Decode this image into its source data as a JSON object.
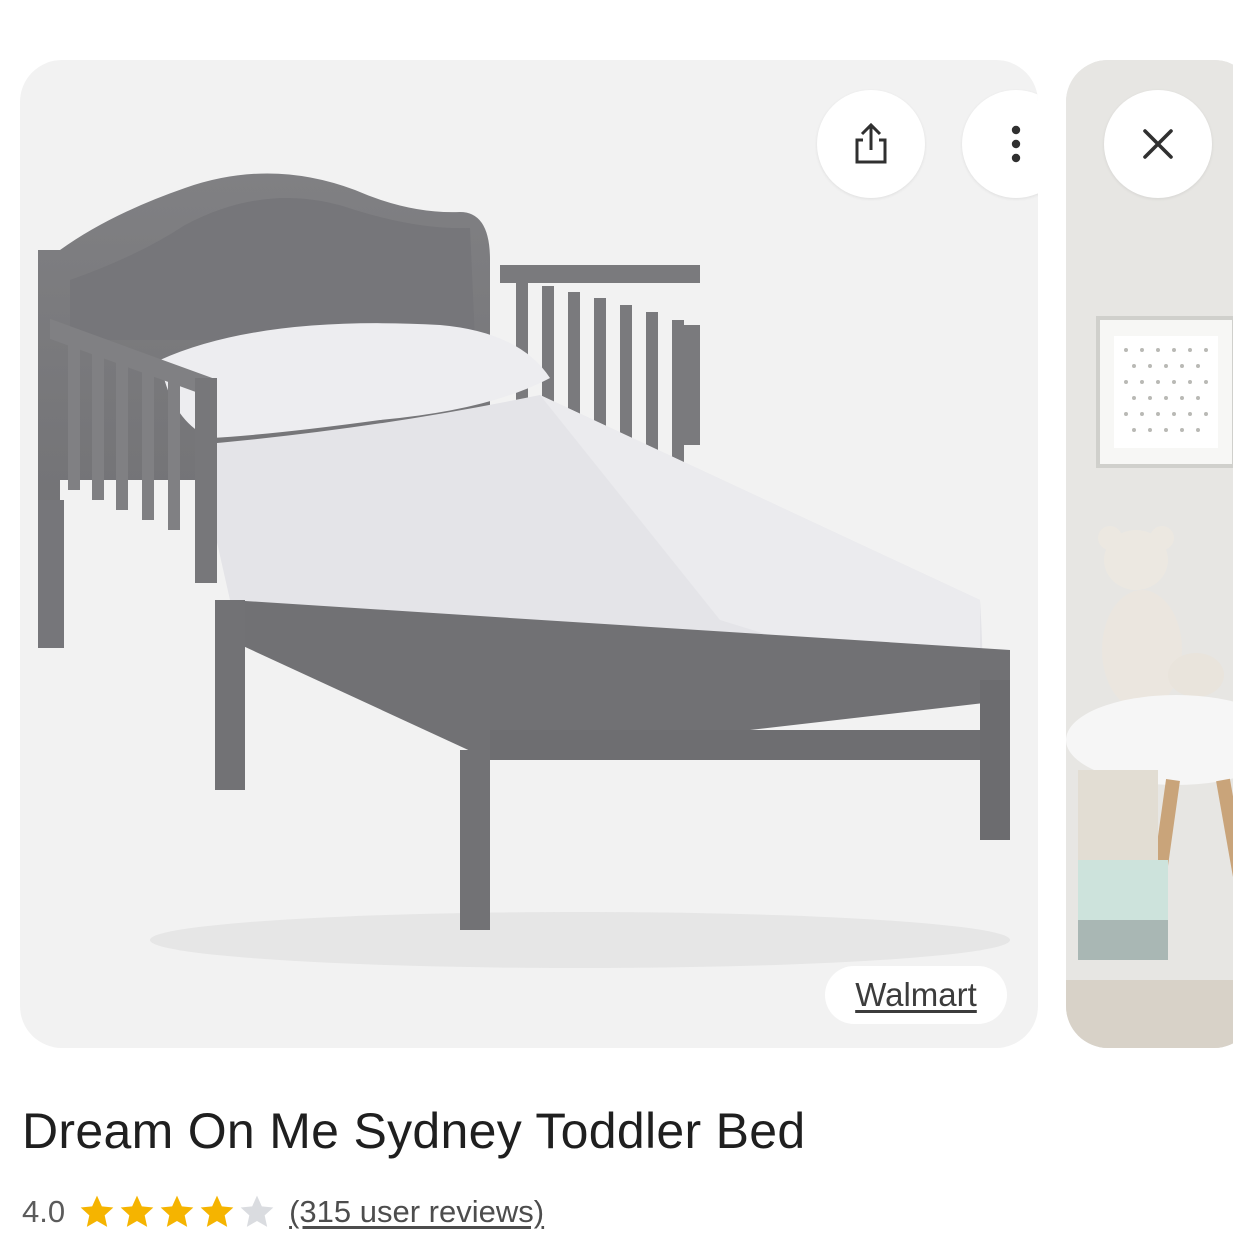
{
  "product": {
    "title": "Dream On Me Sydney Toddler Bed",
    "source": "Walmart",
    "rating": "4.0",
    "rating_value": 4,
    "rating_max": 5,
    "reviews": "(315 user reviews)"
  },
  "actions": {
    "share_icon": "share-icon",
    "more_icon": "more-vert-icon",
    "close_icon": "close-icon"
  },
  "colors": {
    "star_filled": "#f5b400",
    "star_empty": "#dadce0",
    "card_bg": "#f2f2f2"
  }
}
